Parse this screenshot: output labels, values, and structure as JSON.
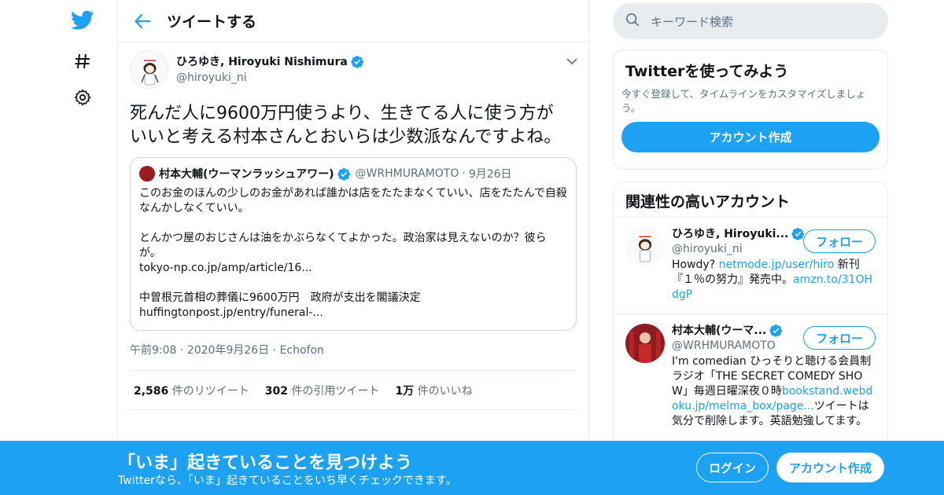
{
  "header": {
    "title": "ツイートする"
  },
  "tweet": {
    "author_name": "ひろゆき, Hiroyuki Nishimura",
    "author_handle": "@hiroyuki_ni",
    "text": "死んだ人に9600万円使うより、生きてる人に使う方がいいと考える村本さんとおいらは少数派なんですよね。",
    "quote": {
      "name": "村本大輔(ウーマンラッシュアワー)",
      "handle": "@WRHMURAMOTO",
      "date": "9月26日",
      "body": "このお金のほんの少しのお金があれば誰かは店をたたまなくていい、店をたたんで自殺なんかしなくていい。\n\nとんかつ屋のおじさんは油をかぶらなくてよかった。政治家は見えないのか？彼らが。\ntokyo-np.co.jp/amp/article/16...\n\n中曽根元首相の葬儀に9600万円　政府が支出を閣議決定\nhuffingtonpost.jp/entry/funeral-..."
    },
    "time": "午前9:08",
    "date": "2020年9月26日",
    "source": "Echofon",
    "retweets_count": "2,586",
    "retweets_label": "件のリツイート",
    "quotes_count": "302",
    "quotes_label": "件の引用ツイート",
    "likes_count": "1万",
    "likes_label": "件のいいね"
  },
  "search": {
    "placeholder": "キーワード検索"
  },
  "signup_card": {
    "title": "Twitterを使ってみよう",
    "description": "今すぐ登録して、タイムラインをカスタマイズしましょう。",
    "button": "アカウント作成"
  },
  "related": {
    "title": "関連性の高いアカウント",
    "accounts": [
      {
        "name": "ひろゆき, Hiroyuki...",
        "handle": "@hiroyuki_ni",
        "follow": "フォロー",
        "bio_pre": "Howdy? ",
        "bio_link1": "netmode.jp/user/hiro",
        "bio_mid": " 新刊『１％の努力』発売中。",
        "bio_link2": "amzn.to/31OHdgP"
      },
      {
        "name": "村本大輔(ウーマ...",
        "handle": "@WRHMURAMOTO",
        "follow": "フォロー",
        "bio_pre": "I'm comedian ひっそりと聴ける会員制ラジオ「THE SECRET COMEDY SHOW」毎週日曜深夜０時",
        "bio_link1": "bookstand.webdoku.jp/melma_box/page...",
        "bio_mid": "ツイートは気分で削除します。英語勉強してます。"
      }
    ]
  },
  "bottom_bar": {
    "title": "「いま」起きていることを見つけよう",
    "subtitle": "Twitterなら、「いま」起きていることをいち早くチェックできます。",
    "login": "ログイン",
    "signup": "アカウント作成"
  },
  "colors": {
    "accent": "#1da1f2",
    "border": "#e6ecf0",
    "secondary_text": "#5b7083"
  }
}
